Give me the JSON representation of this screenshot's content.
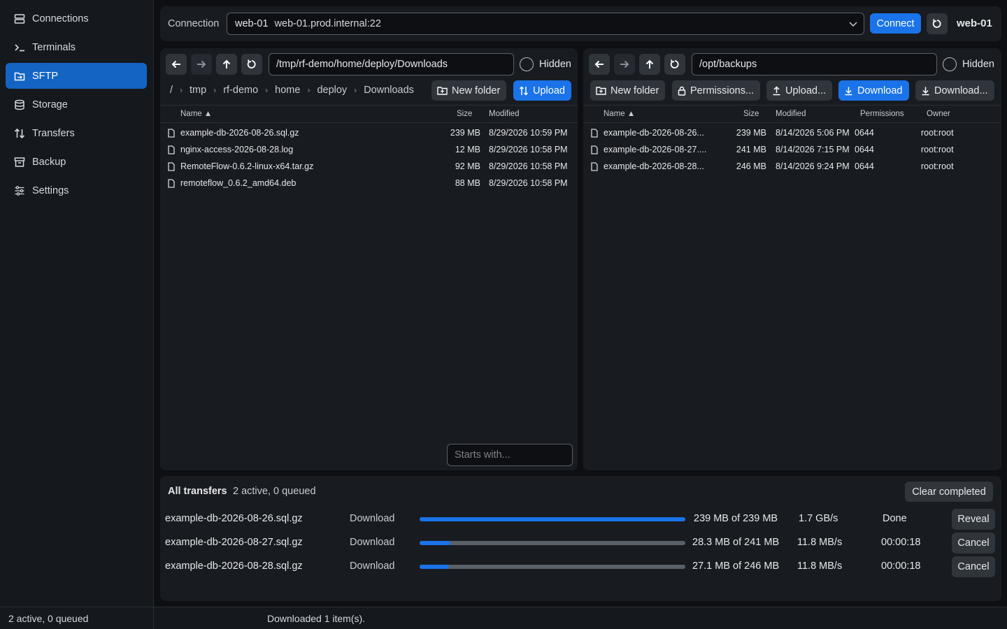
{
  "sidebar": {
    "items": [
      {
        "label": "Connections",
        "icon": "server-icon"
      },
      {
        "label": "Terminals",
        "icon": "terminal-icon"
      },
      {
        "label": "SFTP",
        "icon": "folder-transfer-icon",
        "active": true
      },
      {
        "label": "Storage",
        "icon": "database-icon"
      },
      {
        "label": "Transfers",
        "icon": "transfer-arrows-icon"
      },
      {
        "label": "Backup",
        "icon": "archive-icon"
      },
      {
        "label": "Settings",
        "icon": "sliders-icon"
      }
    ]
  },
  "connection": {
    "label": "Connection",
    "selected_name": "web-01",
    "selected_host": "web-01.prod.internal:22",
    "connect_label": "Connect",
    "active_name": "web-01"
  },
  "left_pane": {
    "path": "/tmp/rf-demo/home/deploy/Downloads",
    "hidden_label": "Hidden",
    "breadcrumbs": [
      "/",
      "tmp",
      "rf-demo",
      "home",
      "deploy",
      "Downloads"
    ],
    "new_folder_label": "New folder",
    "upload_label": "Upload",
    "columns": {
      "name": "Name ▲",
      "size": "Size",
      "modified": "Modified"
    },
    "files": [
      {
        "name": "example-db-2026-08-26.sql.gz",
        "size": "239 MB",
        "modified": "8/29/2026 10:59 PM"
      },
      {
        "name": "nginx-access-2026-08-28.log",
        "size": "12 MB",
        "modified": "8/29/2026 10:58 PM"
      },
      {
        "name": "RemoteFlow-0.6.2-linux-x64.tar.gz",
        "size": "92 MB",
        "modified": "8/29/2026 10:58 PM"
      },
      {
        "name": "remoteflow_0.6.2_amd64.deb",
        "size": "88 MB",
        "modified": "8/29/2026 10:58 PM"
      }
    ],
    "filter_placeholder": "Starts with..."
  },
  "right_pane": {
    "path": "/opt/backups",
    "hidden_label": "Hidden",
    "new_folder_label": "New folder",
    "permissions_label": "Permissions...",
    "upload_label": "Upload...",
    "download_label": "Download",
    "download_as_label": "Download...",
    "columns": {
      "name": "Name ▲",
      "size": "Size",
      "modified": "Modified",
      "permissions": "Permissions",
      "owner": "Owner"
    },
    "files": [
      {
        "name": "example-db-2026-08-26...",
        "size": "239 MB",
        "modified": "8/14/2026 5:06 PM",
        "permissions": "0644",
        "owner": "root:root"
      },
      {
        "name": "example-db-2026-08-27....",
        "size": "241 MB",
        "modified": "8/14/2026 7:15 PM",
        "permissions": "0644",
        "owner": "root:root"
      },
      {
        "name": "example-db-2026-08-28...",
        "size": "246 MB",
        "modified": "8/14/2026 9:24 PM",
        "permissions": "0644",
        "owner": "root:root"
      }
    ]
  },
  "transfers": {
    "title": "All transfers",
    "summary": "2 active, 0 queued",
    "clear_label": "Clear completed",
    "items": [
      {
        "name": "example-db-2026-08-26.sql.gz",
        "kind": "Download",
        "progress": 1.0,
        "amount": "239 MB of 239 MB",
        "speed": "1.7 GB/s",
        "eta": "Done",
        "action": "Reveal"
      },
      {
        "name": "example-db-2026-08-27.sql.gz",
        "kind": "Download",
        "progress": 0.117,
        "amount": "28.3 MB of 241 MB",
        "speed": "11.8 MB/s",
        "eta": "00:00:18",
        "action": "Cancel"
      },
      {
        "name": "example-db-2026-08-28.sql.gz",
        "kind": "Download",
        "progress": 0.11,
        "amount": "27.1 MB of 246 MB",
        "speed": "11.8 MB/s",
        "eta": "00:00:18",
        "action": "Cancel"
      }
    ]
  },
  "status": {
    "left": "2 active, 0 queued",
    "message": "Downloaded 1 item(s)."
  },
  "colors": {
    "accent": "#1a73e8",
    "background": "#0d0f13",
    "panel": "#181b20"
  }
}
